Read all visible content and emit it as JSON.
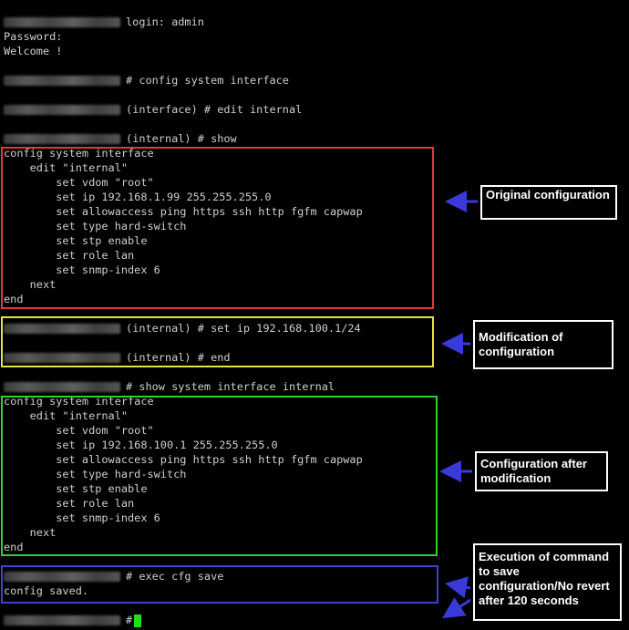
{
  "terminal": {
    "lines": {
      "l01": "login: admin",
      "l02": "Password:",
      "l03": "Welcome !",
      "l04": "# config system interface",
      "l05": "(interface) # edit internal",
      "l06": "(internal) # show",
      "l07": "config system interface",
      "l08": "    edit \"internal\"",
      "l09": "        set vdom \"root\"",
      "l10": "        set ip 192.168.1.99 255.255.255.0",
      "l11": "        set allowaccess ping https ssh http fgfm capwap",
      "l12": "        set type hard-switch",
      "l13": "        set stp enable",
      "l14": "        set role lan",
      "l15": "        set snmp-index 6",
      "l16": "    next",
      "l17": "end",
      "l18": "(internal) # set ip 192.168.100.1/24",
      "l19": "(internal) # end",
      "l20": "# show system interface internal",
      "l21": "config system interface",
      "l22": "    edit \"internal\"",
      "l23": "        set vdom \"root\"",
      "l24": "        set ip 192.168.100.1 255.255.255.0",
      "l25": "        set allowaccess ping https ssh http fgfm capwap",
      "l26": "        set type hard-switch",
      "l27": "        set stp enable",
      "l28": "        set role lan",
      "l29": "        set snmp-index 6",
      "l30": "    next",
      "l31": "end",
      "l32": "# exec cfg save",
      "l33": "config saved.",
      "l34": "#"
    }
  },
  "callouts": {
    "original": "Original configuration",
    "modification": "Modification of configuration",
    "after": "Configuration after modification",
    "execution": "Execution of command to save configuration/No revert after 120 seconds"
  },
  "colors": {
    "red_box": "#e03a3a",
    "yellow_box": "#e6e04a",
    "green_box": "#2fd02f",
    "blue_box": "#4040d0",
    "arrow": "#3a3ad8",
    "cursor": "#22dd22"
  }
}
